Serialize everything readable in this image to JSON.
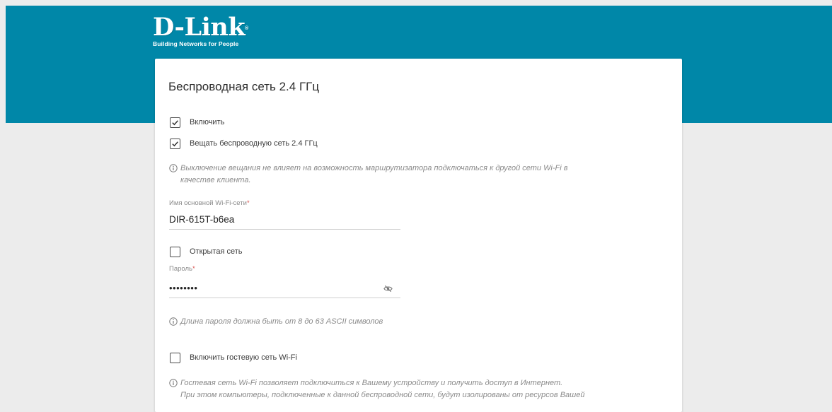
{
  "brand": {
    "name": "D-Link",
    "tagline": "Building Networks for People"
  },
  "section": {
    "title": "Беспроводная сеть 2.4 ГГц"
  },
  "enable": {
    "label": "Включить",
    "checked": true
  },
  "broadcast": {
    "label": "Вещать беспроводную сеть 2.4 ГГц",
    "checked": true
  },
  "broadcast_note": "Выключение вещания не влияет на возможность маршрутизатора подключаться к другой сети Wi-Fi в\nкачестве клиента.",
  "ssid": {
    "label": "Имя основной Wi-Fi-сети",
    "required_mark": "*",
    "value": "DIR-615T-b6ea"
  },
  "open_network": {
    "label": "Открытая сеть",
    "checked": false
  },
  "password": {
    "label": "Пароль",
    "required_mark": "*",
    "value": "••••••••"
  },
  "password_note": "Длина пароля должна быть от 8 до 63 ASCII символов",
  "guest": {
    "label": "Включить гостевую сеть Wi-Fi",
    "checked": false
  },
  "guest_note": "Гостевая сеть Wi-Fi позволяет подключиться к Вашему устройству и получить доступ в Интернет.\nПри этом компьютеры, подключенные к данной беспроводной сети, будут изолированы от ресурсов Вашей",
  "colors": {
    "header": "#0087a8",
    "background": "#ececec",
    "card": "#ffffff",
    "required": "#d9534f"
  },
  "icons": {
    "check": "check-icon",
    "info": "info-icon",
    "password_toggle": "eye-slash-icon"
  }
}
